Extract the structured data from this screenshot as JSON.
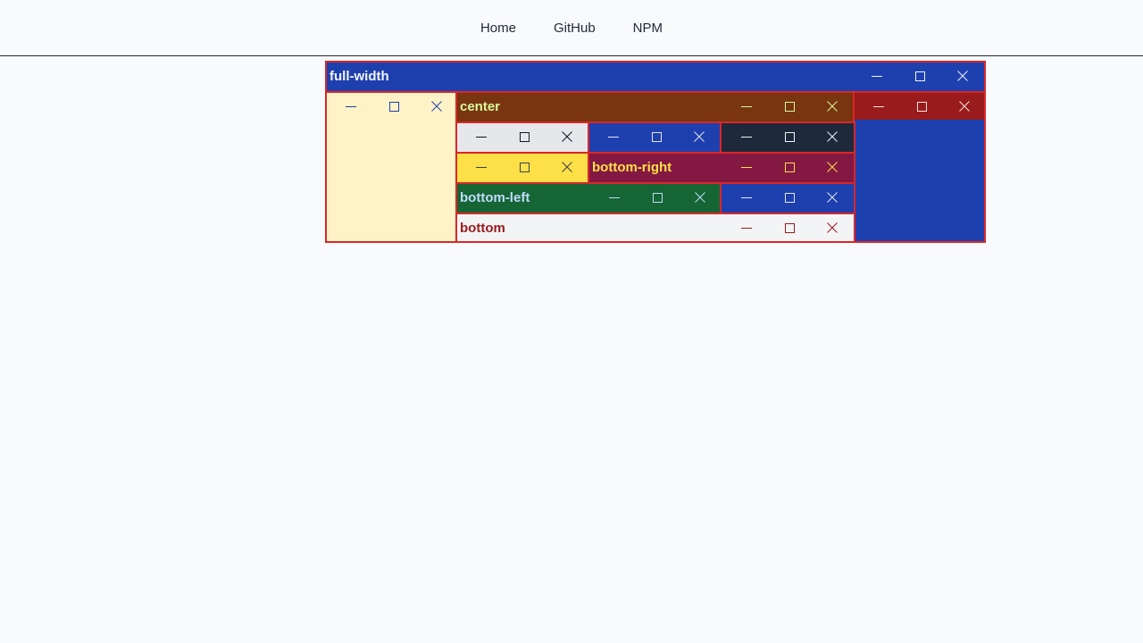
{
  "nav": {
    "home": "Home",
    "github": "GitHub",
    "npm": "NPM"
  },
  "panes": {
    "full_width": {
      "title": "full-width",
      "bg": "#1e40af",
      "fg": "#f1f5f9"
    },
    "left": {
      "title": "",
      "bg": "#fef3c7",
      "fg": "#1e40af"
    },
    "center": {
      "title": "center",
      "bg": "#78350f",
      "fg": "#d9f99d"
    },
    "right": {
      "title": "",
      "bg": "#991b1b",
      "fg": "#fee2e2",
      "body_bg": "#1e40af"
    },
    "row2_a": {
      "title": "",
      "bg": "#e5e7eb",
      "fg": "#111827"
    },
    "row2_b": {
      "title": "",
      "bg": "#1e40af",
      "fg": "#e5e7eb"
    },
    "row2_c": {
      "title": "",
      "bg": "#1e293b",
      "fg": "#f1f5f9"
    },
    "row3_a": {
      "title": "",
      "bg": "#fde047",
      "fg": "#374151"
    },
    "bottom_right": {
      "title": "bottom-right",
      "bg": "#831843",
      "fg": "#fde047"
    },
    "bottom_left": {
      "title": "bottom-left",
      "bg": "#166534",
      "fg": "#bfdbfe"
    },
    "row4_b": {
      "title": "",
      "bg": "#1e40af",
      "fg": "#e5e7eb"
    },
    "bottom": {
      "title": "bottom",
      "bg": "#f3f4f6",
      "fg": "#991b1b"
    }
  },
  "icons": {
    "minimize": "minimize-icon",
    "maximize": "maximize-icon",
    "close": "close-icon"
  }
}
